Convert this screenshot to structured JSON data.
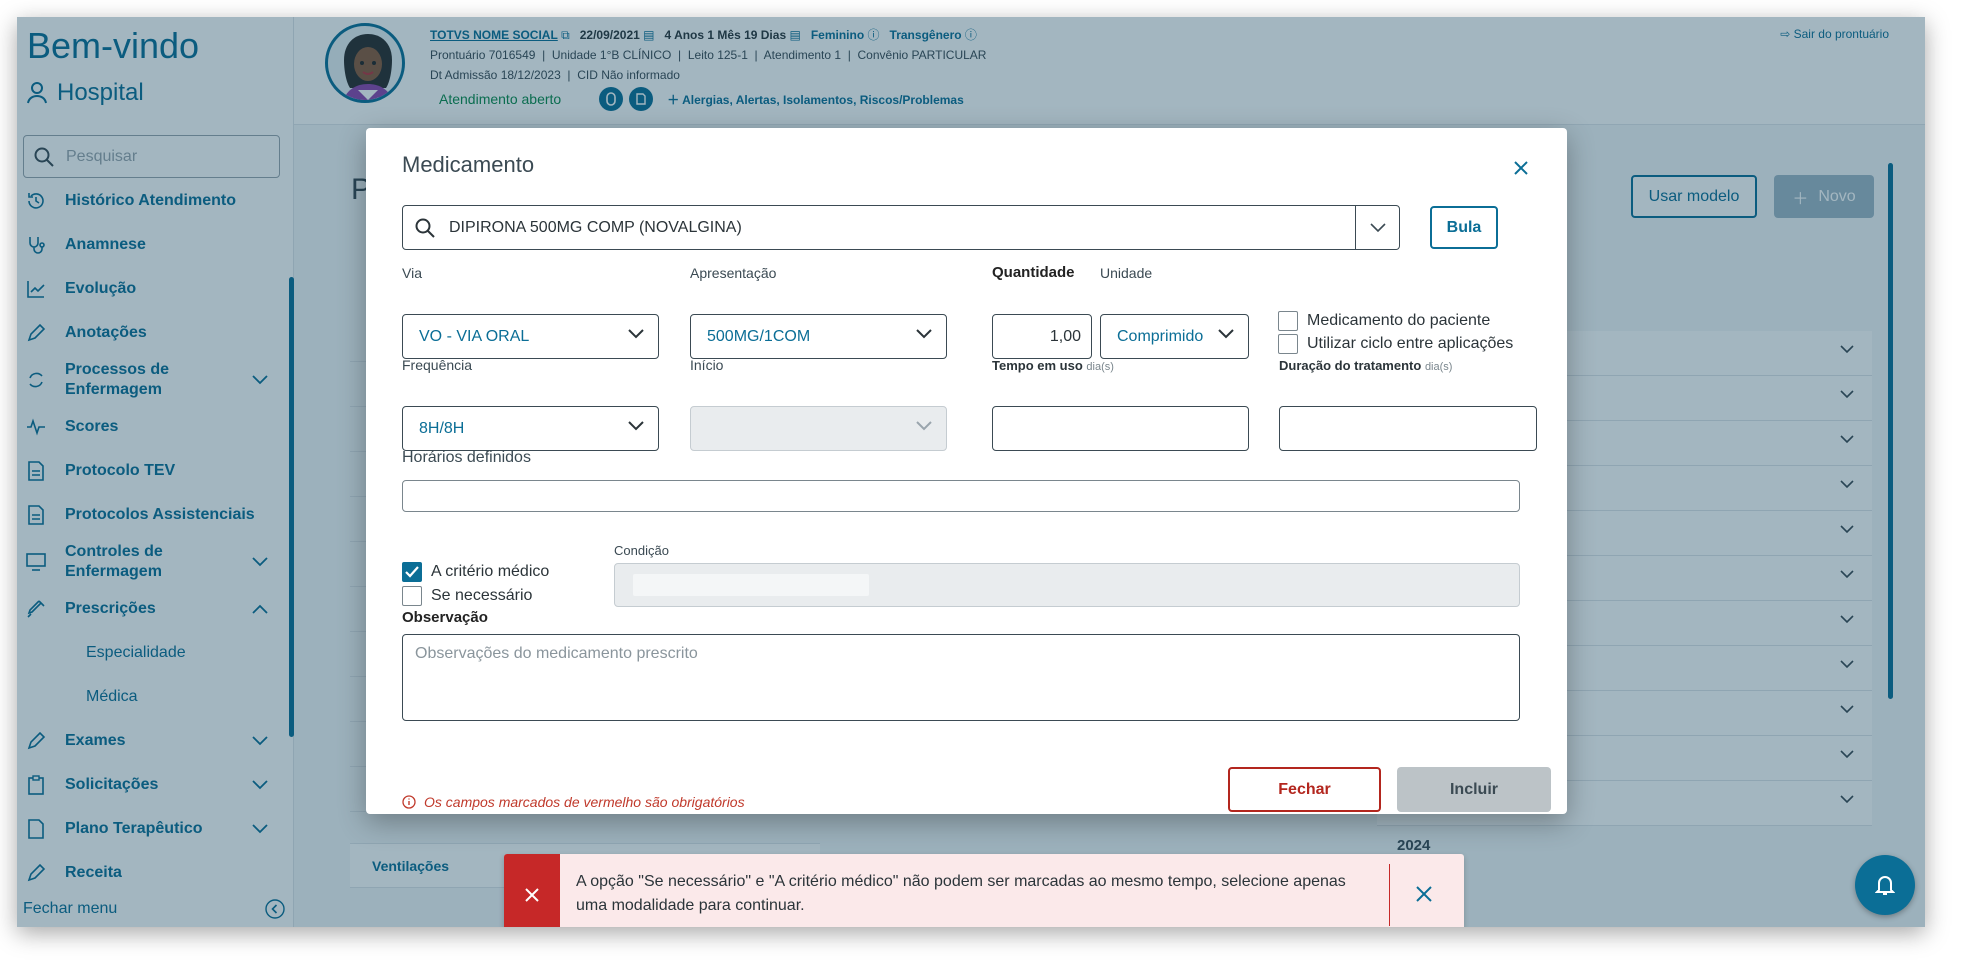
{
  "sidebar": {
    "brand_title": "Bem-vindo",
    "brand_sub": "Hospital",
    "search_placeholder": "Pesquisar",
    "items": [
      {
        "label": "Histórico Atendimento"
      },
      {
        "label": "Anamnese"
      },
      {
        "label": "Evolução"
      },
      {
        "label": "Anotações"
      },
      {
        "label": "Processos de Enfermagem"
      },
      {
        "label": "Scores"
      },
      {
        "label": "Protocolo TEV"
      },
      {
        "label": "Protocolos Assistenciais"
      },
      {
        "label": "Controles de Enfermagem"
      },
      {
        "label": "Prescrições"
      },
      {
        "label": "Especialidade"
      },
      {
        "label": "Médica"
      },
      {
        "label": "Exames"
      },
      {
        "label": "Solicitações"
      },
      {
        "label": "Plano Terapêutico"
      },
      {
        "label": "Receita"
      }
    ],
    "close_menu": "Fechar menu"
  },
  "header": {
    "social_name": "TOTVS NOME SOCIAL",
    "birth": "22/09/2021",
    "age": "4 Anos 1 Mês 19 Dias",
    "gender": "Feminino",
    "trans": "Transgênero",
    "line2": "Prontuário 7016549  |  Unidade 1°B CLÍNICO  |  Leito 125-1  |  Atendimento 1  |  Convênio PARTICULAR",
    "line3": "Dt Admissão 18/12/2023  |  CID Não informado",
    "status": "Atendimento aberto",
    "alerts": "Alergias, Alertas, Isolamentos, Riscos/Problemas",
    "leave": "Sair do prontuário"
  },
  "background": {
    "use_model": "Usar modelo",
    "new": "Novo",
    "ventilacoes": "Ventilações",
    "year": "2024"
  },
  "modal": {
    "title": "Medicamento",
    "medication": "DIPIRONA 500MG COMP (NOVALGINA)",
    "bula": "Bula",
    "via_label": "Via",
    "via_value": "VO - VIA ORAL",
    "apresentacao_label": "Apresentação",
    "apresentacao_value": "500MG/1COM",
    "quantidade_label": "Quantidade",
    "quantidade_value": "1,00",
    "unidade_label": "Unidade",
    "unidade_value": "Comprimido",
    "chk_paciente": "Medicamento do paciente",
    "chk_ciclo": "Utilizar ciclo entre aplicações",
    "frequencia_label": "Frequência",
    "frequencia_value": "8H/8H",
    "inicio_label": "Início",
    "tempo_label": "Tempo em uso",
    "duracao_label": "Duração do tratamento",
    "dias_hint": "dia(s)",
    "horarios_label": "Horários definidos",
    "chk_criterio": "A critério médico",
    "chk_necessario": "Se necessário",
    "condicao_label": "Condição",
    "observacao_label": "Observação",
    "observacao_placeholder": "Observações do medicamento prescrito",
    "required_note": "Os campos marcados de vermelho são obrigatórios",
    "fechar": "Fechar",
    "incluir": "Incluir"
  },
  "toast": {
    "message": "A opção \"Se necessário\" e \"A critério médico\" não podem ser marcadas ao mesmo tempo, selecione apenas uma modalidade para continuar."
  }
}
